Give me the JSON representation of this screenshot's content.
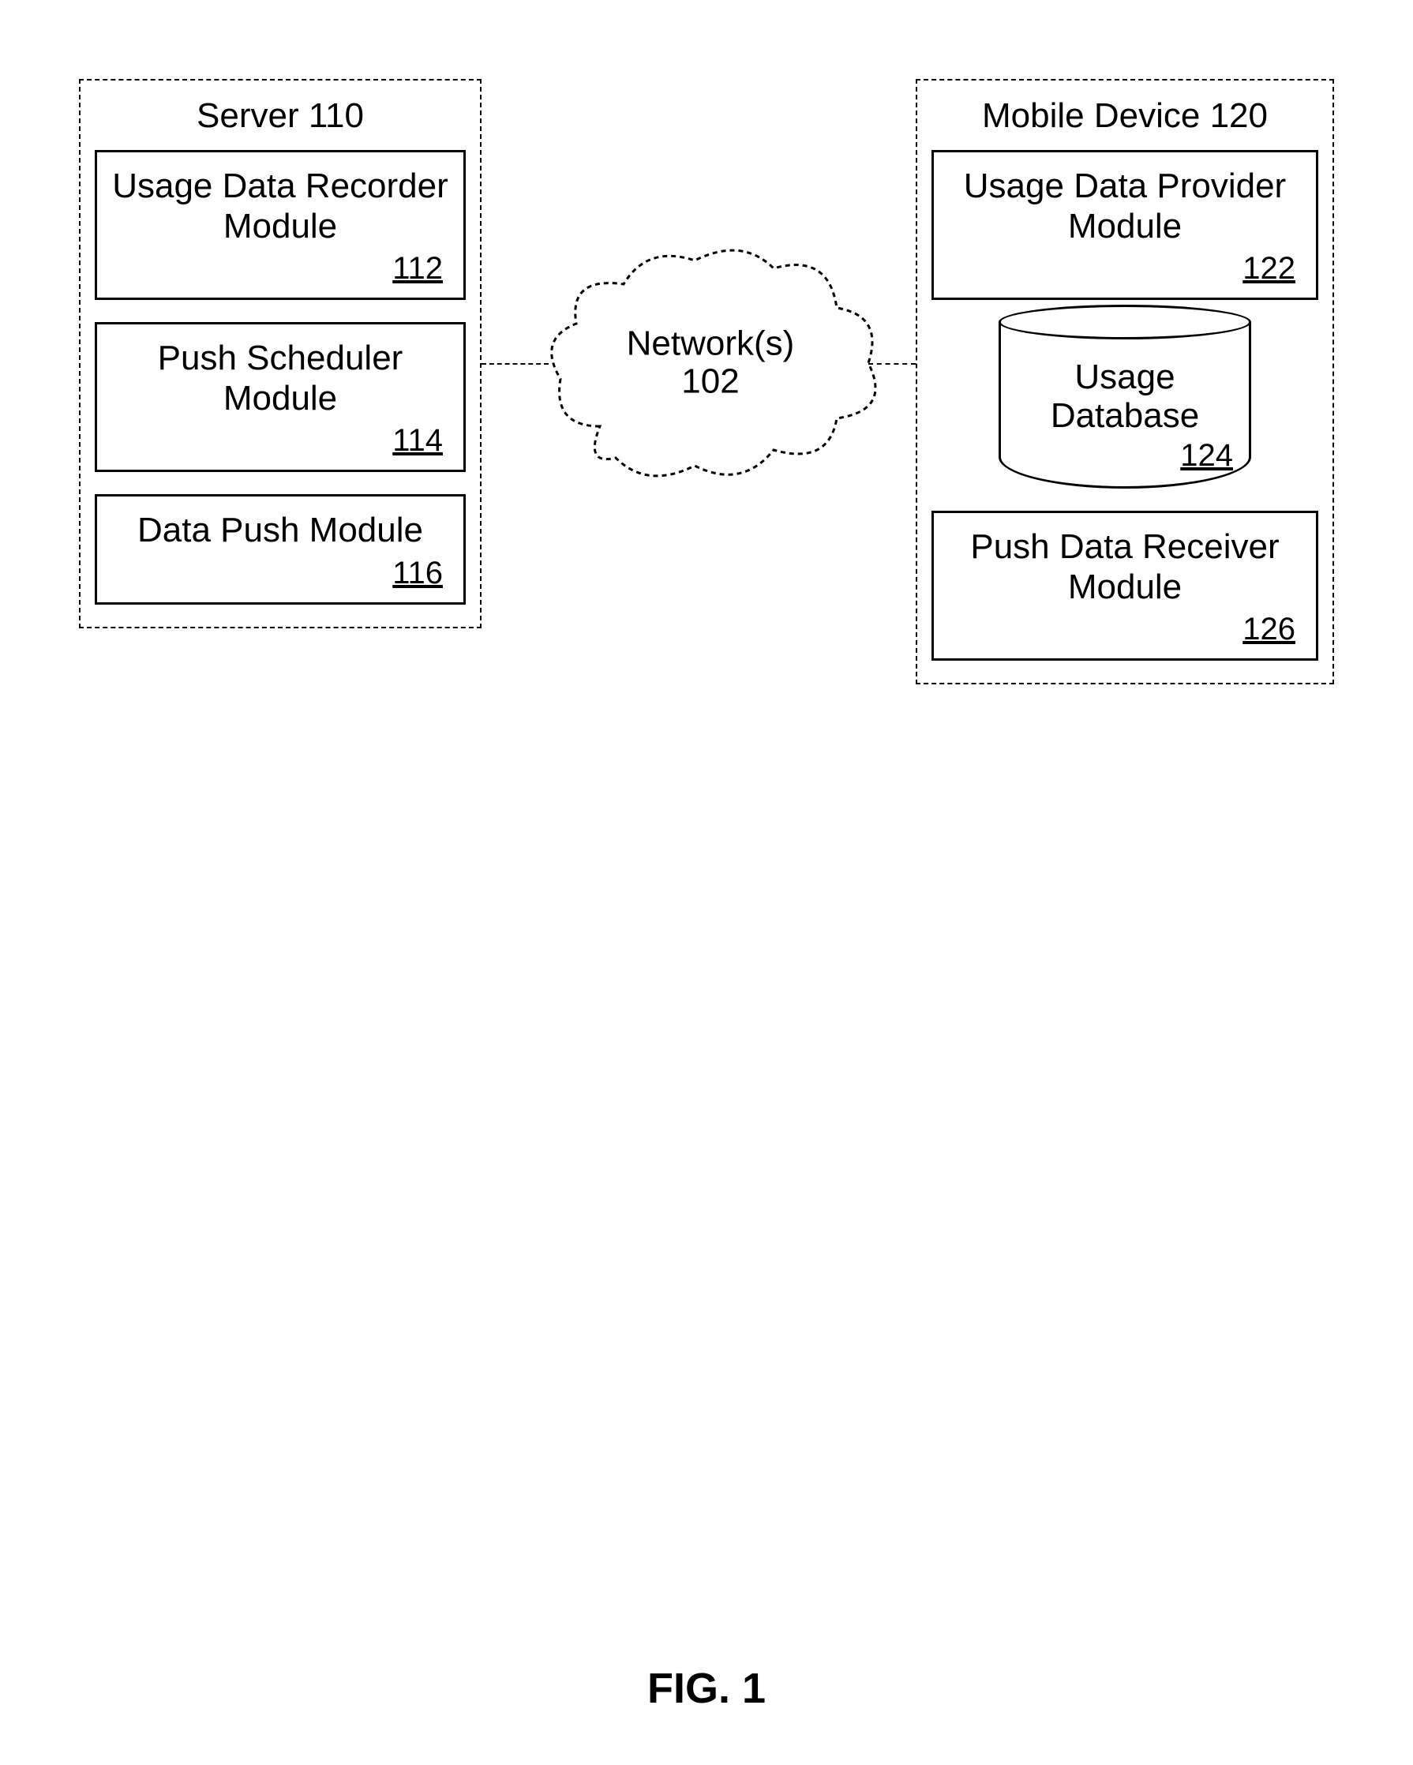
{
  "figure_label": "FIG. 1",
  "server": {
    "title": "Server 110",
    "modules": [
      {
        "text": "Usage Data Recorder Module",
        "num": "112"
      },
      {
        "text": "Push Scheduler Module",
        "num": "114"
      },
      {
        "text": "Data Push Module",
        "num": "116"
      }
    ]
  },
  "network": {
    "label": "Network(s)",
    "num": "102"
  },
  "mobile": {
    "title": "Mobile Device 120",
    "modules": [
      {
        "text": "Usage Data Provider Module",
        "num": "122"
      }
    ],
    "database": {
      "text": "Usage Database",
      "num": "124"
    },
    "modules2": [
      {
        "text": "Push Data Receiver Module",
        "num": "126"
      }
    ]
  }
}
